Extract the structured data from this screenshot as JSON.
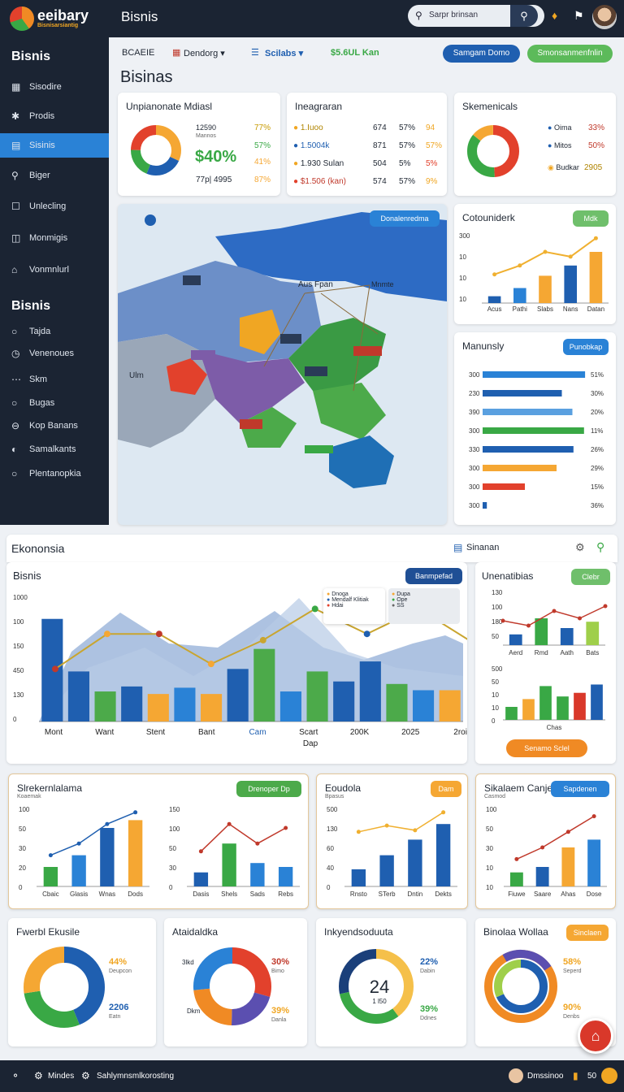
{
  "app": {
    "logo": "eeibary",
    "logo_sub": "Bisnisarsiantig",
    "title": "Bisnis"
  },
  "search": {
    "placeholder": "Sarpr brinsan"
  },
  "sidebar": {
    "heading1": "Bisnis",
    "items1": [
      {
        "label": "Sisodire",
        "icon": "grid-icon"
      },
      {
        "label": "Prodis",
        "icon": "puzzle-icon"
      },
      {
        "label": "Sisinis",
        "icon": "chart-icon"
      },
      {
        "label": "Biger",
        "icon": "search-icon"
      },
      {
        "label": "Unlecling",
        "icon": "box-icon"
      },
      {
        "label": "Monmigis",
        "icon": "file-icon"
      },
      {
        "label": "Vonmnlurl",
        "icon": "home-icon"
      }
    ],
    "heading2": "Bisnis",
    "items2": [
      {
        "label": "Tajda"
      },
      {
        "label": "Venenoues"
      },
      {
        "label": "Skm"
      },
      {
        "label": "Bugas"
      },
      {
        "label": "Kop Banans"
      },
      {
        "label": "Samalkants"
      },
      {
        "label": "Plentanopkia"
      }
    ]
  },
  "toolbar": {
    "t1": "BCAEIE",
    "t2": "Dendorg",
    "t3": "Scilabs",
    "t4": "$5.6UL Kan",
    "btn1": "Samgam Domo",
    "btn2": "Smonsanmenfnlin"
  },
  "page_title": "Bisinas",
  "cards_top": {
    "c1": {
      "title": "Unpianonate Mdiasl",
      "v1": "12590",
      "v1b": "Mannos",
      "big": "$40%",
      "v2": "77p| 4995",
      "p1": "77%",
      "p2": "57%",
      "p3": "41%",
      "p4": "87%"
    },
    "c2": {
      "title": "Ineagraran",
      "rows": [
        {
          "a": "1.Iuoo",
          "b": "674",
          "c": "57%",
          "d": "94"
        },
        {
          "a": "1.5004k",
          "b": "871",
          "c": "57%",
          "d": "57%"
        },
        {
          "a": "1.930 Sulan",
          "b": "504",
          "c": "5%",
          "d": "5%"
        },
        {
          "a": "$1.506 (kan)",
          "b": "574",
          "c": "57%",
          "d": "9%"
        }
      ]
    },
    "c3": {
      "title": "Skemenicals",
      "l1": "Oima",
      "v1": "33%",
      "l2": "Mitos",
      "v2": "50%",
      "l3": "Budkar",
      "v3": "2905"
    }
  },
  "map": {
    "btn": "Donalenredma",
    "labels": [
      "Aus Fpan",
      "Mnmte",
      "Ulm"
    ]
  },
  "cotound": {
    "title": "Cotouniderk",
    "btn": "Mdk",
    "y": [
      "300",
      "10",
      "10",
      "10"
    ],
    "x": [
      "Acus",
      "Pathi",
      "Slabs",
      "Nans",
      "Datan"
    ],
    "values": [
      10,
      22,
      40,
      55,
      75
    ],
    "line": [
      42,
      55,
      75,
      68,
      95
    ]
  },
  "manunsly": {
    "title": "Manunsly",
    "btn": "Punobkap",
    "rows": [
      {
        "y": "300",
        "pct": "51%",
        "v": 0.97,
        "c": "#2a82d6"
      },
      {
        "y": "230",
        "pct": "30%",
        "v": 0.75,
        "c": "#1f5fb0"
      },
      {
        "y": "390",
        "pct": "20%",
        "v": 0.85,
        "c": "#5aa0e0"
      },
      {
        "y": "300",
        "pct": "11%",
        "v": 0.96,
        "c": "#39a845"
      },
      {
        "y": "330",
        "pct": "26%",
        "v": 0.86,
        "c": "#1f5fb0"
      },
      {
        "y": "300",
        "pct": "29%",
        "v": 0.7,
        "c": "#f5a733"
      },
      {
        "y": "300",
        "pct": "15%",
        "v": 0.4,
        "c": "#e2412c"
      },
      {
        "y": "300",
        "pct": "36%",
        "v": 0.04,
        "c": "#1f5fb0"
      }
    ]
  },
  "eko": {
    "title": "Ekononsia",
    "right": "Sinanan"
  },
  "mainchart": {
    "title": "Bisnis",
    "btn": "Banmpefad",
    "y": [
      "1000",
      "100",
      "150",
      "450",
      "130",
      "0"
    ],
    "x": [
      "Mont",
      "Want",
      "Stent",
      "Bant",
      "Cam",
      "Scart",
      "200K",
      "2025",
      "2roit"
    ],
    "x2": "Dap",
    "legend": [
      "Dnoga",
      "Mendalf Klitiak",
      "Hdai",
      "Dupa",
      "Ope",
      "SS"
    ],
    "bars": [
      82,
      40,
      24,
      28,
      22,
      27,
      22,
      42,
      58,
      24,
      40,
      32,
      48,
      30,
      25,
      25
    ],
    "line": [
      42,
      70,
      70,
      46,
      65,
      90,
      70,
      90,
      64
    ]
  },
  "unenatibias": {
    "title": "Unenatibias",
    "btn": "Clebr",
    "btn2": "Senamo Sclel",
    "x": [
      "Aerd",
      "Rmd",
      "Aath",
      "Bats"
    ],
    "x2": "Chas",
    "y": [
      "130",
      "100",
      "180",
      "50"
    ],
    "y2": [
      "500",
      "50",
      "10",
      "10",
      "0"
    ],
    "bars1": [
      22,
      55,
      35,
      48
    ],
    "bars2": [
      25,
      40,
      65,
      45,
      52,
      68
    ],
    "line": [
      50,
      40,
      70,
      55,
      80
    ]
  },
  "row3": [
    {
      "title": "Slrekernlalama",
      "sub": "Koaemak",
      "btn": "Drenoper Dp",
      "y": [
        "100",
        "50",
        "30",
        "20",
        "0"
      ],
      "x": [
        "Cbaic",
        "Glasis",
        "Wnas",
        "Dods"
      ],
      "bars": [
        25,
        40,
        75,
        85
      ],
      "line": [
        40,
        55,
        80,
        95
      ]
    },
    {
      "title": "",
      "sub": "",
      "btn": "",
      "y": [
        "150",
        "100",
        "50",
        "30",
        "0"
      ],
      "x": [
        "Dasis",
        "Shels",
        "Sads",
        "Rebs"
      ],
      "bars": [
        18,
        55,
        30,
        25
      ],
      "line": [
        45,
        80,
        55,
        75
      ]
    },
    {
      "title": "Eoudola",
      "sub": "Bpasus",
      "btn": "Dam",
      "y": [
        "500",
        "130",
        "60",
        "40",
        "0"
      ],
      "x": [
        "Rnsto",
        "STerb",
        "Dntin",
        "Dekts"
      ],
      "bars": [
        22,
        40,
        60,
        80
      ],
      "line": [
        70,
        78,
        72,
        95
      ]
    },
    {
      "title": "Sikalaem Canje",
      "sub": "Casmod",
      "btn": "Sapdenen",
      "y": [
        "100",
        "50",
        "30",
        "10",
        "10"
      ],
      "x": [
        "Fiuwe",
        "Saare",
        "Ahas",
        "Dose"
      ],
      "bars": [
        18,
        25,
        50,
        60
      ],
      "line": [
        35,
        50,
        70,
        90
      ]
    }
  ],
  "row4": [
    {
      "title": "Fwerbl Ekusile",
      "p1": "44%",
      "s1": "Deupcon",
      "p2": "2206",
      "s2": "Eatn"
    },
    {
      "title": "Ataidaldka",
      "l": "3lkd",
      "l2": "Dkm",
      "p1": "30%",
      "s1": "Bimo",
      "p2": "39%",
      "s2": "Danla"
    },
    {
      "title": "Inkyendsoduuta",
      "center": "24",
      "center2": "1 l50",
      "p1": "22%",
      "s1": "Dabin",
      "p2": "39%",
      "s2": "Ddnes"
    },
    {
      "title": "Binolaa Wollaa",
      "btn": "Sinclaen",
      "p1": "58%",
      "s1": "Seperd",
      "p2": "90%",
      "s2": "Denbs"
    }
  ],
  "bottom": {
    "b1": "Mindes",
    "b2": "Sahlymnsmlkorosting",
    "b3": "Dmssinoo",
    "b4": "50"
  }
}
